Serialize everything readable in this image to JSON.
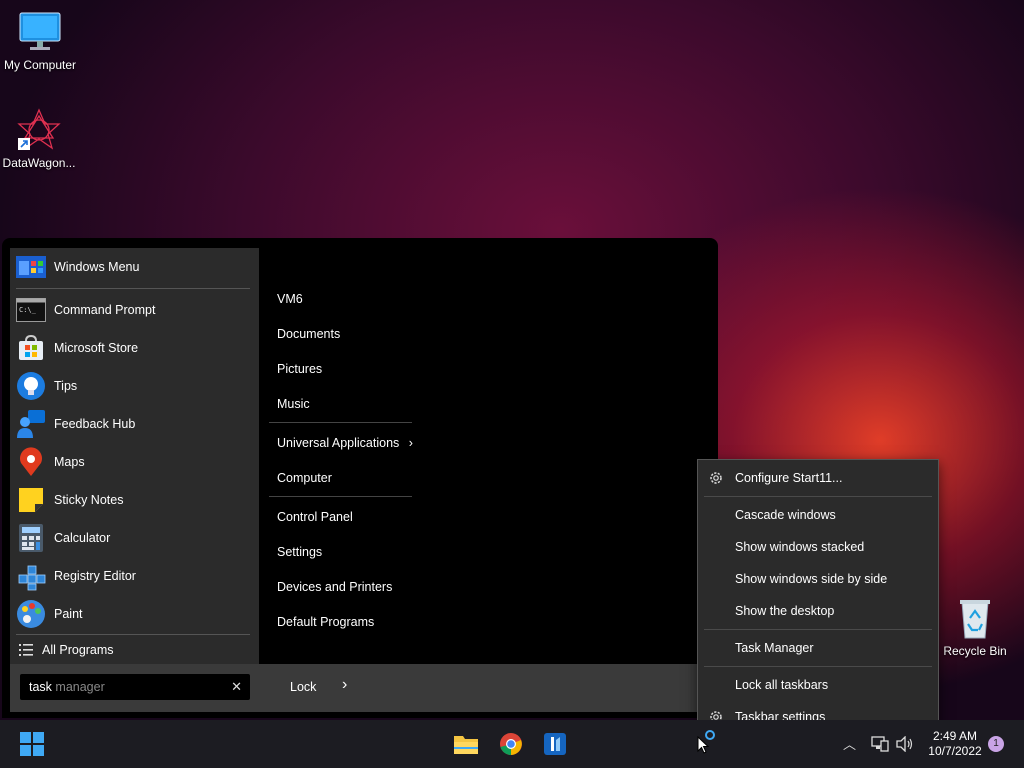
{
  "desktop": {
    "icons": [
      {
        "label": "My Computer",
        "icon": "monitor-icon"
      },
      {
        "label": "DataWagon...",
        "icon": "datawagon-shortcut-icon"
      },
      {
        "label": "Recycle Bin",
        "icon": "recycle-bin-icon"
      }
    ]
  },
  "start_menu": {
    "pinned": [
      {
        "label": "Windows Menu",
        "icon": "windows-menu-icon"
      },
      {
        "label": "Command Prompt",
        "icon": "command-prompt-icon"
      },
      {
        "label": "Microsoft Store",
        "icon": "microsoft-store-icon"
      },
      {
        "label": "Tips",
        "icon": "tips-bulb-icon"
      },
      {
        "label": "Feedback Hub",
        "icon": "feedback-hub-icon"
      },
      {
        "label": "Maps",
        "icon": "maps-pin-icon"
      },
      {
        "label": "Sticky Notes",
        "icon": "sticky-notes-icon"
      },
      {
        "label": "Calculator",
        "icon": "calculator-icon"
      },
      {
        "label": "Registry Editor",
        "icon": "registry-editor-icon"
      },
      {
        "label": "Paint",
        "icon": "paint-palette-icon"
      }
    ],
    "all_programs": "All Programs",
    "places": [
      {
        "label": "VM6"
      },
      {
        "label": "Documents"
      },
      {
        "label": "Pictures"
      },
      {
        "label": "Music"
      },
      {
        "label": "Universal Applications"
      },
      {
        "label": "Computer"
      },
      {
        "label": "Control Panel"
      },
      {
        "label": "Settings"
      },
      {
        "label": "Devices and Printers"
      },
      {
        "label": "Default Programs"
      }
    ],
    "search": {
      "typed": "task",
      "suggestion": " manager"
    },
    "lock_label": "Lock"
  },
  "context_menu": {
    "items": [
      {
        "label": "Configure Start11...",
        "icon": "gear-icon"
      },
      {
        "label": "Cascade windows"
      },
      {
        "label": "Show windows stacked"
      },
      {
        "label": "Show windows side by side"
      },
      {
        "label": "Show the desktop"
      },
      {
        "label": "Task Manager"
      },
      {
        "label": "Lock all taskbars"
      },
      {
        "label": "Taskbar settings",
        "icon": "gear-icon"
      }
    ]
  },
  "taskbar": {
    "time": "2:49 AM",
    "date": "10/7/2022",
    "notification_count": "1"
  },
  "colors": {
    "accent": "#0078d4",
    "menu_bg": "#2b2b2b",
    "taskbar_bg": "#1c1c22"
  }
}
